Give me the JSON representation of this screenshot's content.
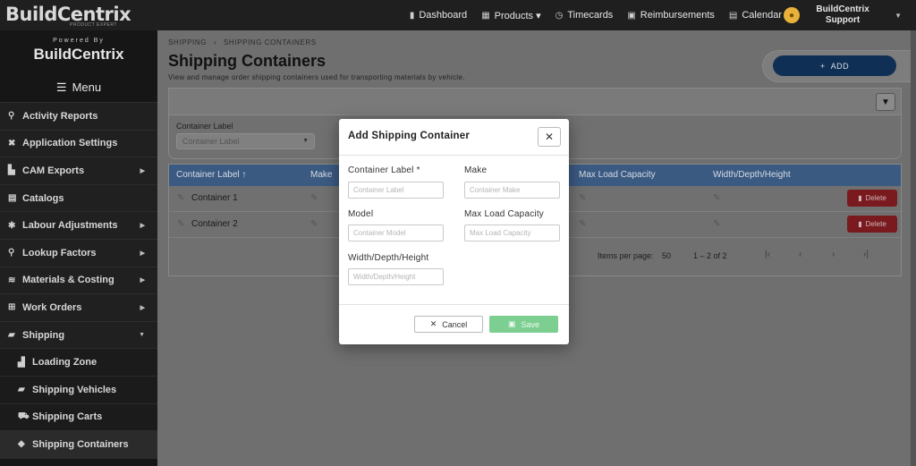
{
  "topbar": {
    "brand": "BuildCentrix",
    "brand_sub": "PRODUCT EXPERT",
    "nav": [
      {
        "label": "Dashboard",
        "icon": "bar-chart-icon"
      },
      {
        "label": "Products ▾",
        "icon": "grid-icon"
      },
      {
        "label": "Timecards",
        "icon": "clock-icon"
      },
      {
        "label": "Reimbursements",
        "icon": "money-icon"
      },
      {
        "label": "Calendar",
        "icon": "calendar-icon"
      }
    ],
    "user": {
      "line1": "BuildCentrix",
      "line2": "Support"
    }
  },
  "sidebar": {
    "powered_by": "Powered By",
    "brand": "BuildCentrix",
    "menu_label": "Menu",
    "items": [
      {
        "label": "Activity Reports",
        "icon": "search-icon",
        "arrow": ""
      },
      {
        "label": "Application Settings",
        "icon": "tools-icon",
        "arrow": ""
      },
      {
        "label": "CAM Exports",
        "icon": "file-export-icon",
        "arrow": "▶"
      },
      {
        "label": "Catalogs",
        "icon": "book-icon",
        "arrow": ""
      },
      {
        "label": "Labour Adjustments",
        "icon": "asterisk-icon",
        "arrow": "▶"
      },
      {
        "label": "Lookup Factors",
        "icon": "search-icon",
        "arrow": "▶"
      },
      {
        "label": "Materials & Costing",
        "icon": "sliders-icon",
        "arrow": "▶"
      },
      {
        "label": "Work Orders",
        "icon": "table-icon",
        "arrow": "▶"
      },
      {
        "label": "Shipping",
        "icon": "truck-icon",
        "arrow": "▼"
      }
    ],
    "sub_items": [
      {
        "label": "Loading Zone",
        "icon": "dolly-icon"
      },
      {
        "label": "Shipping Vehicles",
        "icon": "truck-icon"
      },
      {
        "label": "Shipping Carts",
        "icon": "cart-icon"
      },
      {
        "label": "Shipping Containers",
        "icon": "box-icon"
      }
    ]
  },
  "page": {
    "breadcrumb": [
      "SHIPPING",
      "SHIPPING CONTAINERS"
    ],
    "title": "Shipping Containers",
    "description": "View and manage order shipping containers used for transporting materials by vehicle.",
    "add_label": "ADD",
    "filter": {
      "label": "Container Label",
      "placeholder": "Container Label"
    },
    "table": {
      "columns": [
        "Container Label ↑",
        "Make",
        "Max Load Capacity",
        "Width/Depth/Height"
      ],
      "rows": [
        {
          "label": "Container 1",
          "delete": "Delete"
        },
        {
          "label": "Container 2",
          "delete": "Delete"
        }
      ],
      "items_per_page_label": "Items per page:",
      "items_per_page": "50",
      "range": "1 – 2 of 2"
    }
  },
  "modal": {
    "title": "Add Shipping Container",
    "fields": {
      "container_label": {
        "label": "Container Label *",
        "placeholder": "Container Label"
      },
      "make": {
        "label": "Make",
        "placeholder": "Container Make"
      },
      "model": {
        "label": "Model",
        "placeholder": "Container Model"
      },
      "max_load": {
        "label": "Max Load Capacity",
        "placeholder": "Max Load Capacity"
      },
      "dims": {
        "label": "Width/Depth/Height",
        "placeholder": "Width/Depth/Height"
      }
    },
    "cancel_label": "Cancel",
    "save_label": "Save"
  },
  "colors": {
    "accent": "#0f2f55",
    "table_header": "#3b5a82",
    "delete": "#c62832",
    "save": "#7ccf91"
  }
}
